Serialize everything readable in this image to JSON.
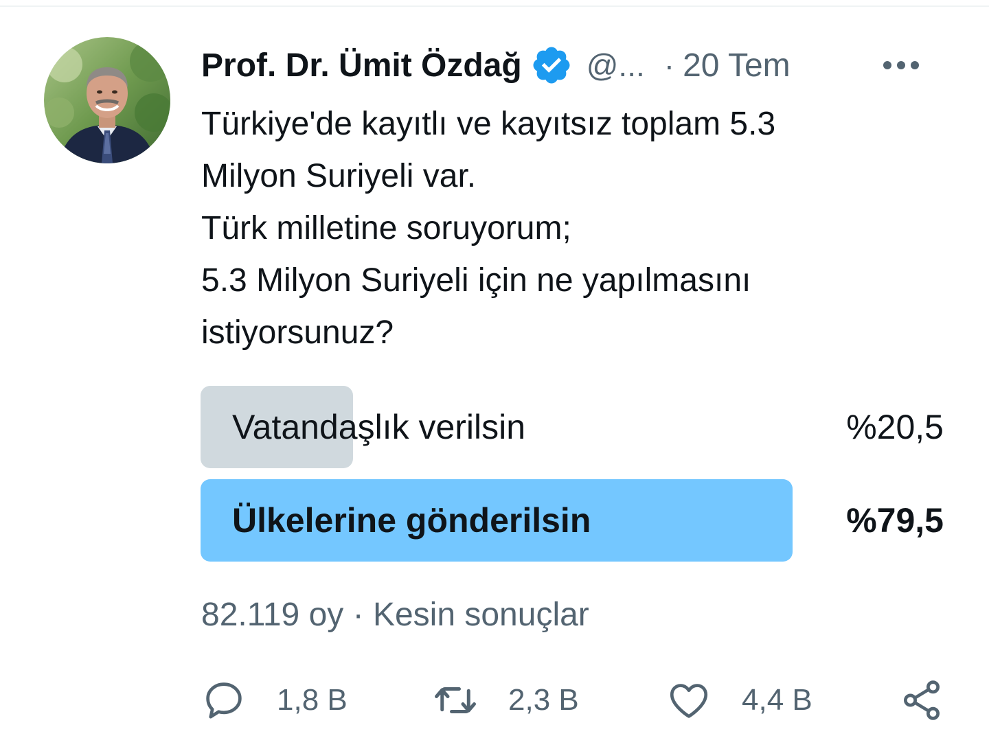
{
  "tweet": {
    "author": {
      "display_name": "Prof. Dr. Ümit Özdağ",
      "handle": "@...",
      "verified": true
    },
    "separator": "·",
    "date": "20 Tem",
    "text_lines": [
      "Türkiye'de kayıtlı ve kayıtsız toplam 5.3",
      "Milyon Suriyeli var.",
      "Türk milletine soruyorum;",
      "5.3 Milyon Suriyeli için ne yapılmasını",
      "istiyorsunuz?"
    ]
  },
  "poll": {
    "options": [
      {
        "label": "Vatandaşlık verilsin",
        "percent_text": "%20,5",
        "percent": 20.5,
        "winner": false
      },
      {
        "label": "Ülkelerine gönderilsin",
        "percent_text": "%79,5",
        "percent": 79.5,
        "winner": true
      }
    ],
    "votes": "82.119 oy",
    "meta_separator": "·",
    "status": "Kesin sonuçlar"
  },
  "actions": {
    "reply_count": "1,8 B",
    "retweet_count": "2,3 B",
    "like_count": "4,4 B"
  },
  "icons": [
    "verified-badge-icon",
    "more-options-icon",
    "reply-icon",
    "retweet-icon",
    "like-icon",
    "share-icon"
  ],
  "colors": {
    "verified": "#1d9bf0",
    "poll_winner_fill": "#74c7ff",
    "poll_loser_fill": "#d0d9de",
    "secondary_text": "#536471",
    "primary_text": "#0f1419"
  }
}
